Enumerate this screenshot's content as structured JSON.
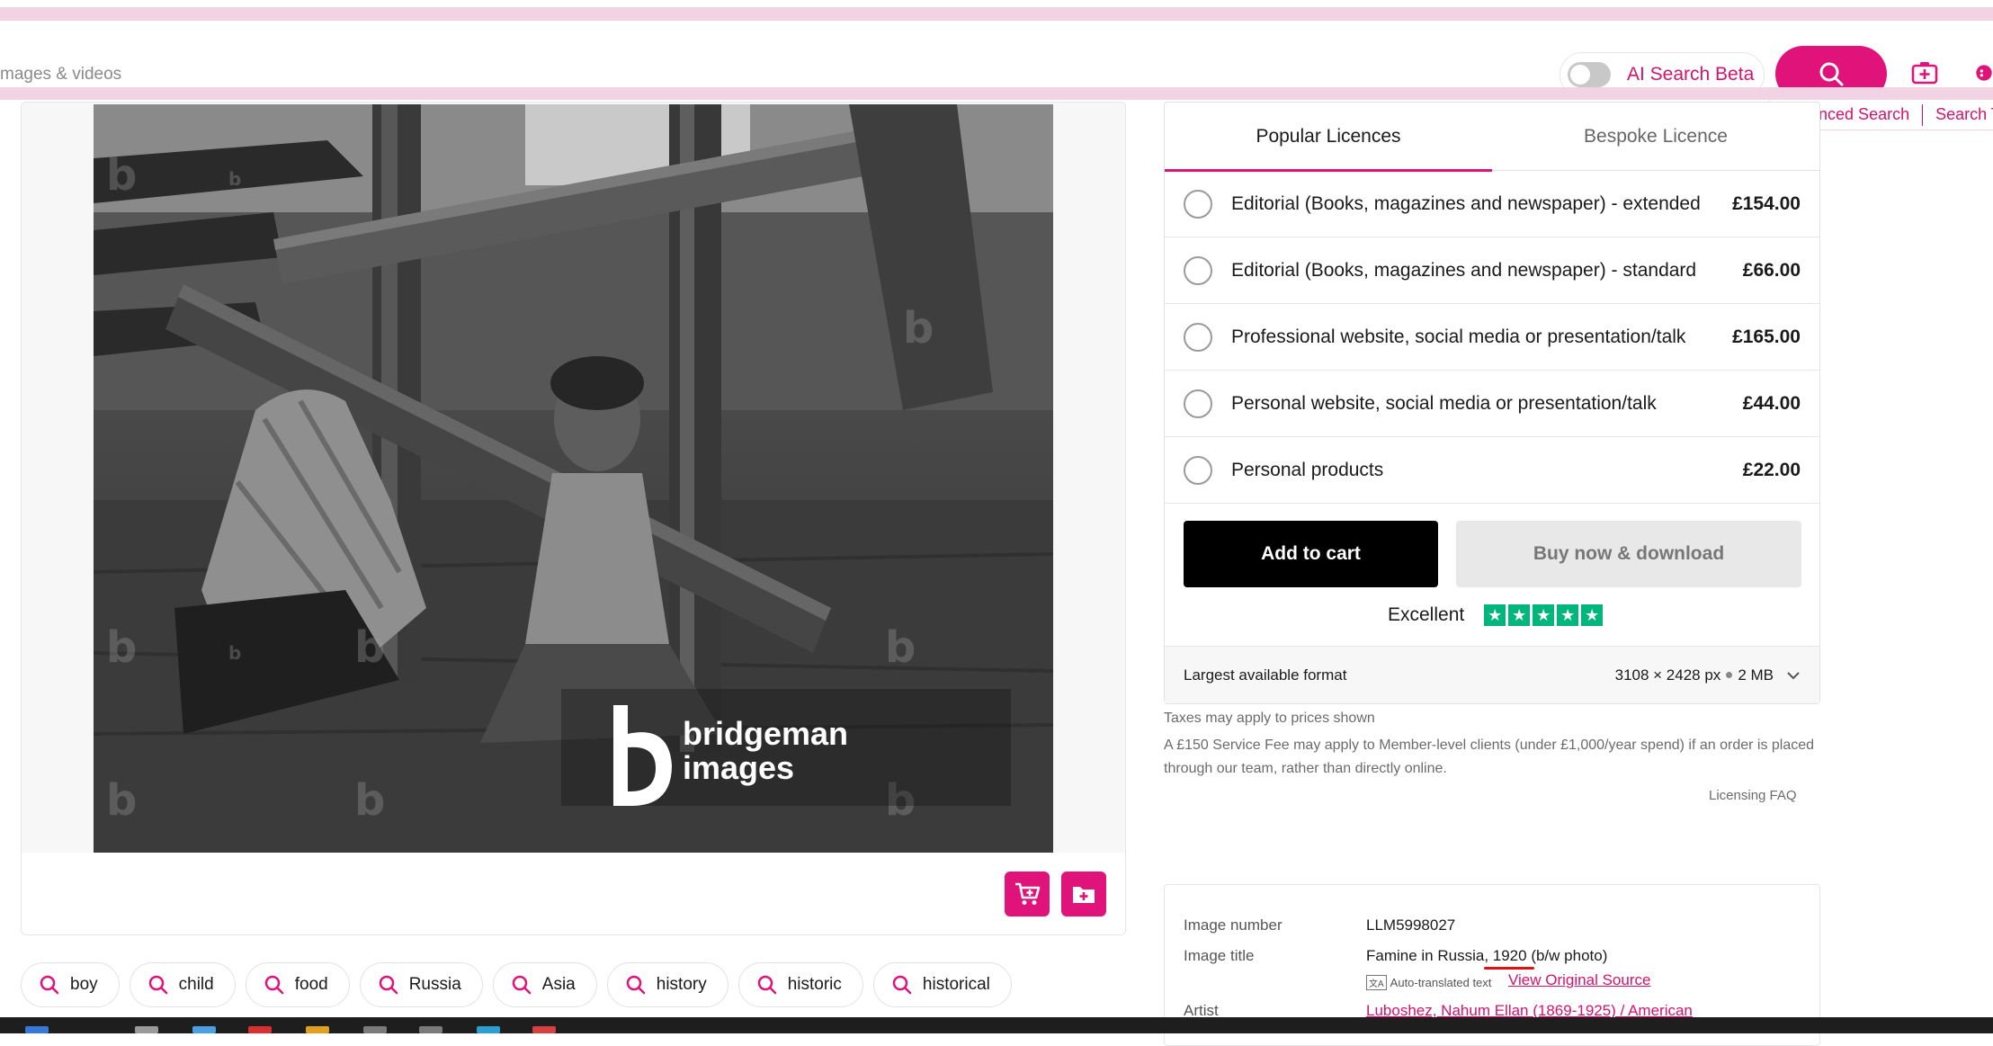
{
  "header": {
    "search_placeholder": "mages & videos",
    "ai_search_label": "AI Search Beta",
    "ai_search_on": false,
    "links": [
      "Advanced Search",
      "Search Ti"
    ]
  },
  "image_card": {
    "watermark_brand_line1": "bridgeman",
    "watermark_brand_line2": "images",
    "actions": [
      "add-to-cart-icon",
      "add-to-lightbox-icon"
    ]
  },
  "tags": [
    "boy",
    "child",
    "food",
    "Russia",
    "Asia",
    "history",
    "historic",
    "historical"
  ],
  "licence": {
    "tabs": [
      "Popular Licences",
      "Bespoke Licence"
    ],
    "active_tab": 0,
    "options": [
      {
        "label": "Editorial (Books, magazines and newspaper) - extended",
        "price": "£154.00"
      },
      {
        "label": "Editorial (Books, magazines and newspaper) - standard",
        "price": "£66.00"
      },
      {
        "label": "Professional website, social media or presentation/talk",
        "price": "£165.00"
      },
      {
        "label": "Personal website, social media or presentation/talk",
        "price": "£44.00"
      },
      {
        "label": "Personal products",
        "price": "£22.00"
      }
    ],
    "add_to_cart": "Add to cart",
    "buy_now": "Buy now & download",
    "trust_label": "Excellent",
    "trust_stars": 5,
    "format_label": "Largest available format",
    "format_dims": "3108 × 2428 px",
    "format_size": "2 MB"
  },
  "notes": {
    "taxes": "Taxes may apply to prices shown",
    "service_fee": "A £150 Service Fee may apply to Member-level clients (under £1,000/year spend) if an order is placed through our team, rather than directly online.",
    "faq": "Licensing FAQ"
  },
  "meta": {
    "image_number_label": "Image number",
    "image_number": "LLM5998027",
    "image_title_label": "Image title",
    "image_title": "Famine in Russia, 1920 (b/w photo)",
    "auto_translated": "Auto-translated text",
    "view_original": "View Original Source",
    "artist_label": "Artist",
    "artist": "Luboshez, Nahum Ellan (1869-1925) / American"
  },
  "colors": {
    "brand": "#e0137a",
    "brand_text": "#d4136e",
    "trust": "#00b67a"
  }
}
